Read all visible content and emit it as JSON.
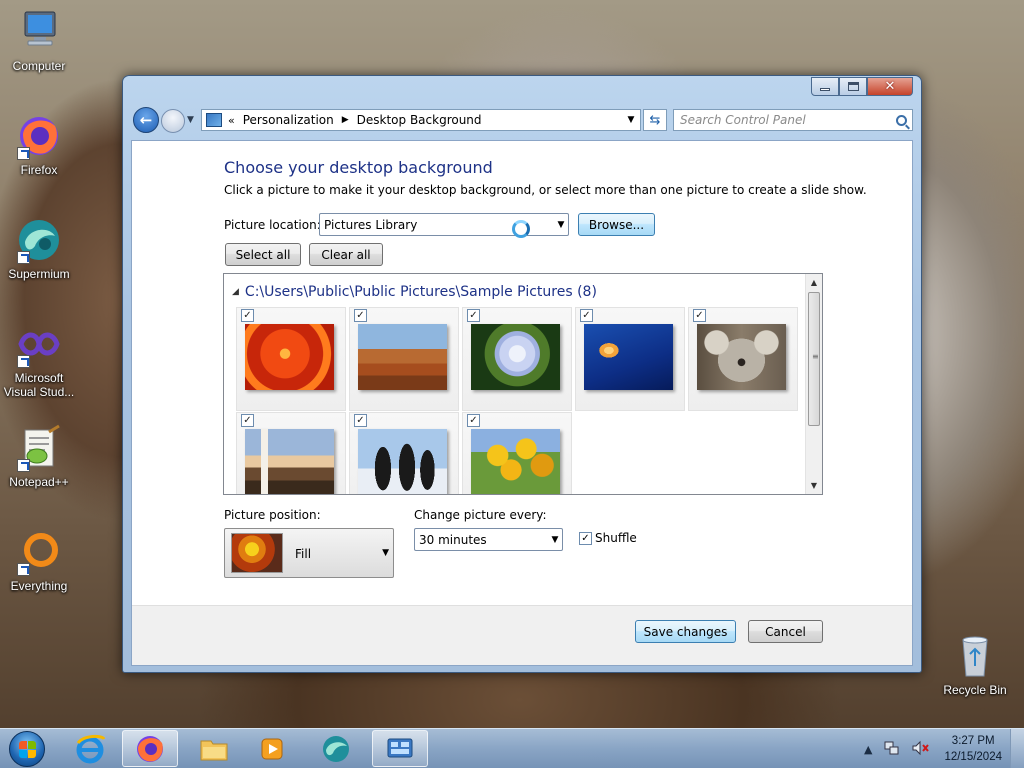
{
  "desktop": {
    "icons": [
      {
        "label": "Computer"
      },
      {
        "label": "Firefox"
      },
      {
        "label": "Supermium"
      },
      {
        "label": "Microsoft Visual Stud..."
      },
      {
        "label": "Notepad++"
      },
      {
        "label": "Everything"
      },
      {
        "label": "Recycle Bin"
      }
    ]
  },
  "window": {
    "controls": {
      "minimize": "minimize",
      "maximize": "maximize",
      "close": "✕"
    },
    "address": {
      "overflow": "«",
      "crumbs": [
        "Personalization",
        "Desktop Background"
      ],
      "separator": "▶",
      "dropdown": "▼"
    },
    "refresh_glyph": "⇆",
    "search_placeholder": "Search Control Panel",
    "heading": "Choose your desktop background",
    "description": "Click a picture to make it your desktop background, or select more than one picture to create a slide show.",
    "picture_location": {
      "label": "Picture location:",
      "value": "Pictures Library"
    },
    "browse_label": "Browse...",
    "select_all_label": "Select all",
    "clear_all_label": "Clear all",
    "gallery": {
      "folder": "C:\\Users\\Public\\Public Pictures\\Sample Pictures (8)",
      "pictures": [
        {
          "subject": "Chrysanthemum",
          "checked": "✓",
          "colors": [
            "#f14a12",
            "#c7260a",
            "#ff7b1d"
          ]
        },
        {
          "subject": "Desert",
          "checked": "✓",
          "colors": [
            "#8fb6de",
            "#b05a25",
            "#7a3a18"
          ]
        },
        {
          "subject": "Hydrangeas",
          "checked": "✓",
          "colors": [
            "#1a3a14",
            "#c9d3f2",
            "#4f7b2a"
          ]
        },
        {
          "subject": "Jellyfish",
          "checked": "✓",
          "colors": [
            "#0d2e86",
            "#f2a33a",
            "#061b5a"
          ]
        },
        {
          "subject": "Koala",
          "checked": "✓",
          "colors": [
            "#c9c2b5",
            "#6a625a",
            "#4a7a2a"
          ]
        },
        {
          "subject": "Lighthouse",
          "checked": "✓",
          "colors": [
            "#9bb6d9",
            "#f0c080",
            "#3a2a1c"
          ]
        },
        {
          "subject": "Penguins",
          "checked": "✓",
          "colors": [
            "#a8c8ea",
            "#1a1a1a",
            "#e9eef5"
          ]
        },
        {
          "subject": "Tulips",
          "checked": "✓",
          "colors": [
            "#8bb0e0",
            "#f5c41a",
            "#e09a10"
          ]
        }
      ]
    },
    "picture_position": {
      "label": "Picture position:",
      "value": "Fill"
    },
    "change_picture": {
      "label": "Change picture every:",
      "value": "30 minutes"
    },
    "shuffle": {
      "label": "Shuffle",
      "checked": "✓"
    },
    "save_label": "Save changes",
    "cancel_label": "Cancel"
  },
  "taskbar": {
    "items": [
      "Start",
      "Internet Explorer",
      "Firefox",
      "Windows Explorer",
      "Windows Media Player",
      "Supermium",
      "Control Panel"
    ],
    "tray": {
      "expand": "▲",
      "time": "3:27 PM",
      "date": "12/15/2024"
    }
  },
  "colors": {
    "heading": "#1e3287",
    "accent": "#1d5db3"
  }
}
